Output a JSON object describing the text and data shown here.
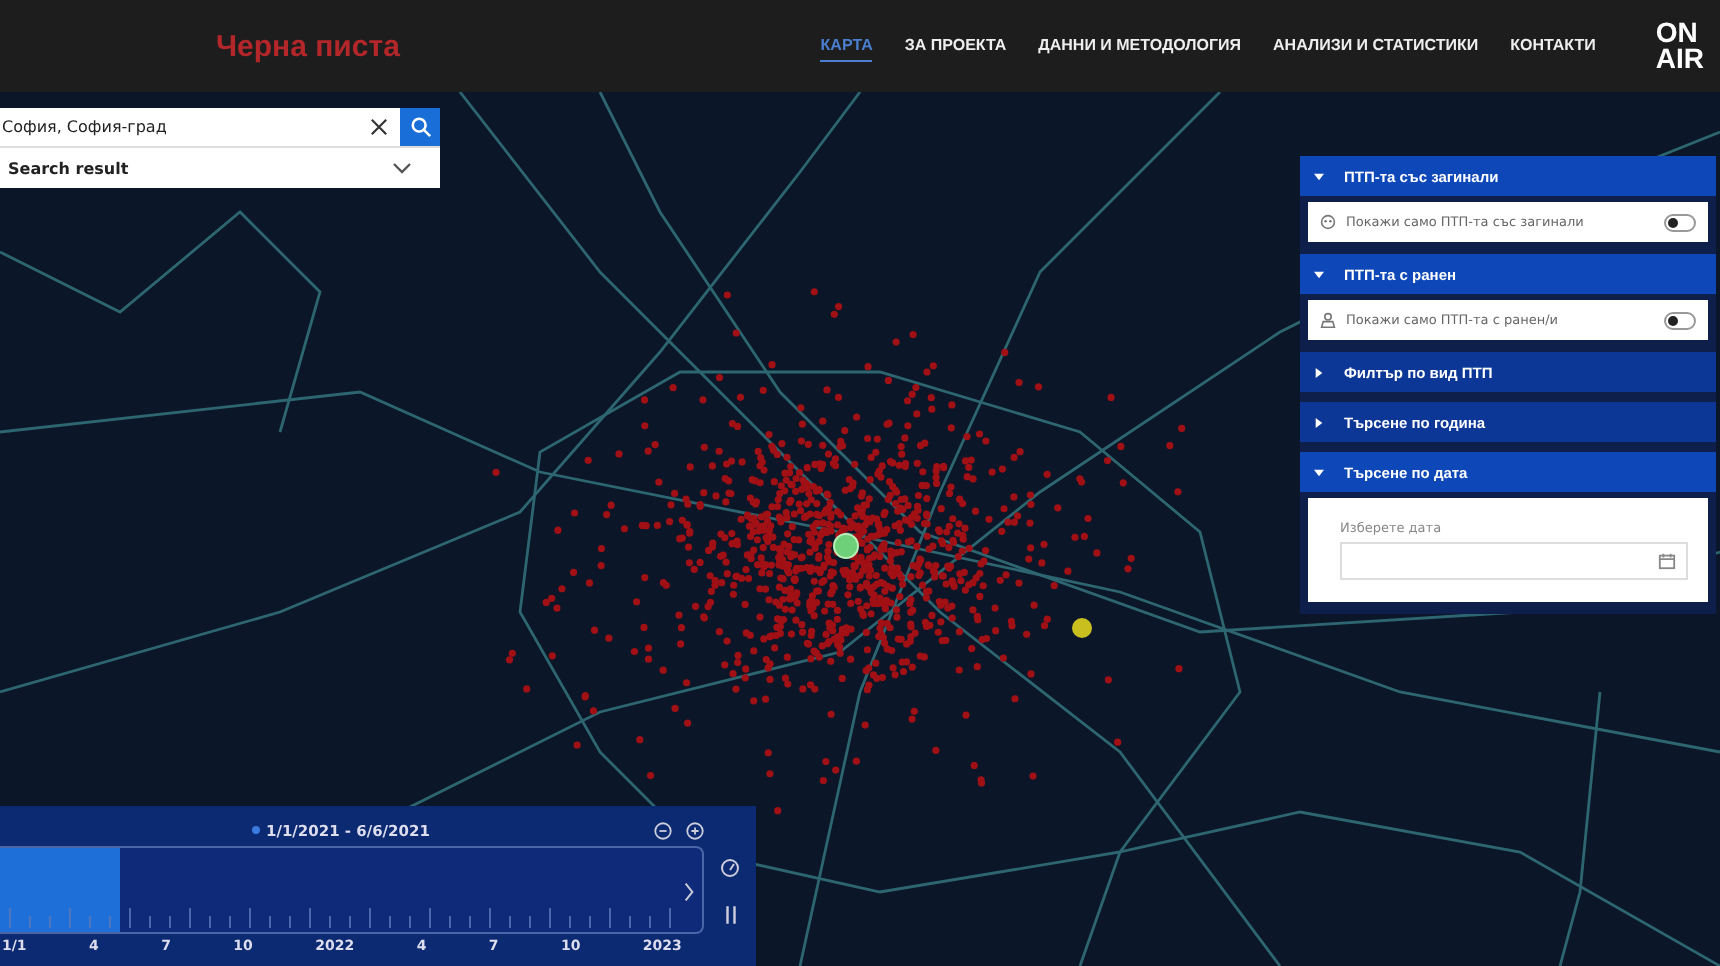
{
  "header": {
    "logo": "Черна писта",
    "nav": [
      {
        "label": "КАРТА",
        "selected": true
      },
      {
        "label": "ЗА ПРОЕКТА",
        "selected": false
      },
      {
        "label": "ДАННИ И МЕТОДОЛОГИЯ",
        "selected": false
      },
      {
        "label": "АНАЛИЗИ И СТАТИСТИКИ",
        "selected": false
      },
      {
        "label": "КОНТАКТИ",
        "selected": false
      }
    ],
    "brand": [
      "ON",
      "AIR"
    ]
  },
  "search": {
    "value": "София, София-град",
    "result": "Search result"
  },
  "filters": [
    {
      "title": "ПТП-та със загинали",
      "expanded": true,
      "kind": "toggle",
      "label": "Покажи само ПТП-та със загинали",
      "on": false
    },
    {
      "title": "ПТП-та с ранен",
      "expanded": true,
      "kind": "toggle",
      "label": "Покажи само ПТП-та с ранен/и",
      "on": false
    },
    {
      "title": "Филтър по вид ПТП",
      "expanded": false
    },
    {
      "title": "Търсене по година",
      "expanded": false
    },
    {
      "title": "Търсене по дата",
      "expanded": true,
      "kind": "date",
      "label": "Изберете дата"
    }
  ],
  "timeline": {
    "range": "1/1/2021 - 6/6/2021",
    "level": 0.17,
    "ticks": [
      "1/1",
      "4",
      "7",
      "10",
      "2022",
      "4",
      "7",
      "10",
      "2023"
    ]
  }
}
